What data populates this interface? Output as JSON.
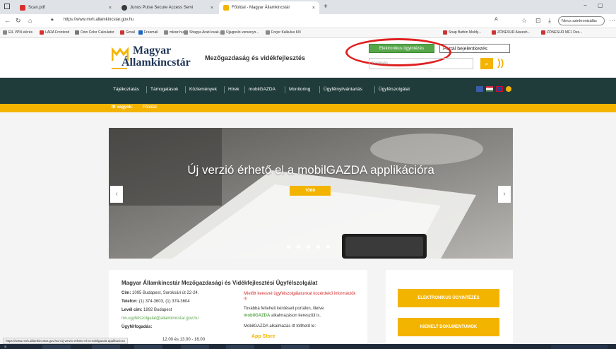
{
  "browser": {
    "tabs": [
      {
        "label": "Scan.pdf"
      },
      {
        "label": "Junos Pulse Secure Access Servi"
      },
      {
        "label": "Főoldal - Magyar Államkincstár"
      }
    ],
    "new_tab": "+",
    "url": "https://www.mvh.allamkincstar.gov.hu",
    "sync_label": "Nincs szinkronizálás",
    "bookmarks": [
      "EIL VPN elérés",
      "LARA Frontend",
      "Own Color Calculator",
      "Gmail",
      "Freemail",
      "mkisz.hu",
      "Shagya Arab lovak...",
      "Újjugoslo versenyn...",
      "Forjer Kalkulus KN",
      "Snap Button Moldy...",
      "ZÖNESUR Alaresh...",
      "ZÖNESUR MF1 Des..."
    ]
  },
  "header": {
    "logo_line1": "Magyar",
    "logo_line2": "Államkincstár",
    "tagline": "Mezőgazdaság és vidékfejlesztés",
    "btn_elektro": "Elektronikus ügyintézés",
    "btn_portal": "Portál bejelentkezés",
    "search_placeholder": "Keresés",
    "search_icon": "search-icon",
    "rss_icon": "rss-icon"
  },
  "nav": {
    "items": [
      "Tájékoztatás",
      "Támogatások",
      "Közlemények",
      "Hírek",
      "mobilGAZDA",
      "Monitoring",
      "Ügyfélnyilvántartás",
      "Ügyfélszolgálat"
    ],
    "flags": [
      "facebook-icon",
      "hungarian-flag-icon",
      "uk-flag-icon",
      "accessibility-icon"
    ]
  },
  "breadcrumb": {
    "label": "Itt vagyok:",
    "value": "Főoldal"
  },
  "slider": {
    "title": "Új verzió érhető el a mobilGAZDA applikációra",
    "more_label": "TÖBB",
    "prev_arrow": "‹",
    "next_arrow": "›",
    "dots": 5,
    "active_dot": 1
  },
  "info": {
    "title": "Magyar Államkincstár Mezőgazdasági és Vidékfejlesztési Ügyfélszolgálat",
    "cim_label": "Cím:",
    "cim_value": "1095 Budapest, Soroksári út 22-24.",
    "telefon_label": "Telefon:",
    "telefon_value": "(1) 374-3603, (1) 374-3604",
    "levelcim_label": "Levél cím:",
    "levelcim_value": "1892 Budapest",
    "email_value": "mv.ugyfelszolgalat@allamkincstar.gov.hu",
    "fogadas_label": "Ügyfélfogadás:",
    "warn": "Mielőtt keresné ügyfélszolgálatunkat kozérdekű információk !!!",
    "note1": "Továbbá felteheti kérdéseit portálon, illetve",
    "note2_green": "mobilGAZDA",
    "note2_rest": " alkalmazáson keresztül is.",
    "note3": "MobilGAZDA alkalmazás itt tölthető le:",
    "appstore": "App Store",
    "time_line": "12.00 és 13.00 - 16.00"
  },
  "side": {
    "btn1": "ELEKTRONIKUS ÜGYINTÉZÉS",
    "btn2": "KIEMELT DOKUMENTUMOK"
  },
  "status": {
    "url": "https://www.mvh.allamkincstar.gov.hu/-/uj-verzio-erheto-el-a-mobilgazda-applikaciora"
  },
  "colors": {
    "navy": "#1f3556",
    "nav_green": "#1f3b3a",
    "accent_yellow": "#f3b400",
    "btn_green": "#57a74a",
    "ellipse_red": "#e02020"
  }
}
